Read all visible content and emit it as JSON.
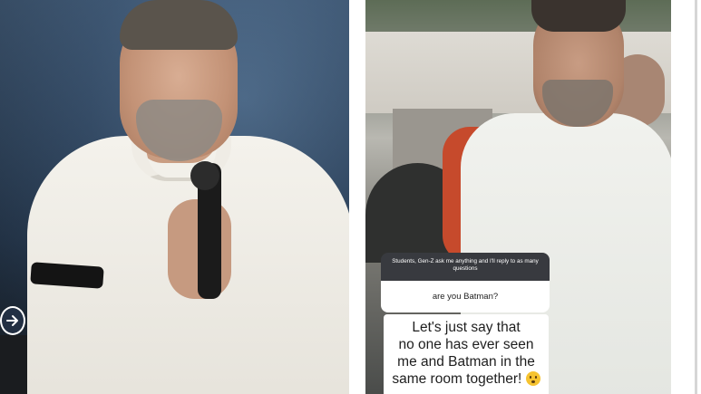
{
  "qa": {
    "prompt": "Students, Gen-Z ask me anything and I'll reply to as many questions",
    "question": "are you Batman?",
    "answer_lines": [
      "Let's just say that",
      "no one has ever seen",
      "me and Batman in the",
      "same room together!"
    ],
    "answer_emoji": "shushing-face-icon"
  },
  "controls": {
    "next_icon": "arrow-right-icon"
  },
  "colors": {
    "card_header": "#383a3f",
    "card_body": "#ffffff",
    "emoji": "#f6c330"
  }
}
